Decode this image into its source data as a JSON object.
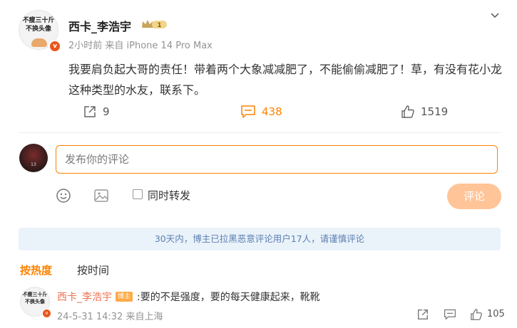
{
  "post": {
    "avatar_text_line1": "不瘦三十斤",
    "avatar_text_line2": "不换头像",
    "verified_badge": "v",
    "username": "西卡_李浩宇",
    "meta": "2小时前 来自 iPhone 14 Pro Max",
    "text": "我要肩负起大哥的责任！带着两个大象减减肥了，不能偷偷减肥了！草，有没有花小龙这种类型的水友，联系下。",
    "share_count": "9",
    "comment_count": "438",
    "like_count": "1519"
  },
  "composer": {
    "avatar_text": "13",
    "placeholder": "发布你的评论",
    "repost_label": "同时转发",
    "submit_label": "评论"
  },
  "notice": "30天内，博主已拉黑恶意评论用户17人，请谨慎评论",
  "sort": {
    "hot_label": "按热度",
    "time_label": "按时间"
  },
  "comments": [
    {
      "avatar_text_line1": "不瘦三十斤",
      "avatar_text_line2": "不换头像",
      "author": "西卡_李浩宇",
      "tag": "博主",
      "text": ":要的不是强度，要的每天健康起来，靴靴",
      "meta": "24-5-31 14:32 来自上海",
      "like_count": "105"
    }
  ],
  "colors": {
    "accent": "#ff8200",
    "notice_bg": "#eaf2fa",
    "notice_text": "#5b7fb0",
    "comment_author": "#eb7350",
    "submit_disabled": "#ffc497"
  },
  "icons": {
    "more": "chevron-down-icon",
    "share": "share-icon",
    "comment": "comment-icon",
    "like": "thumbs-up-icon",
    "emoji": "emoji-icon",
    "image": "image-icon"
  }
}
